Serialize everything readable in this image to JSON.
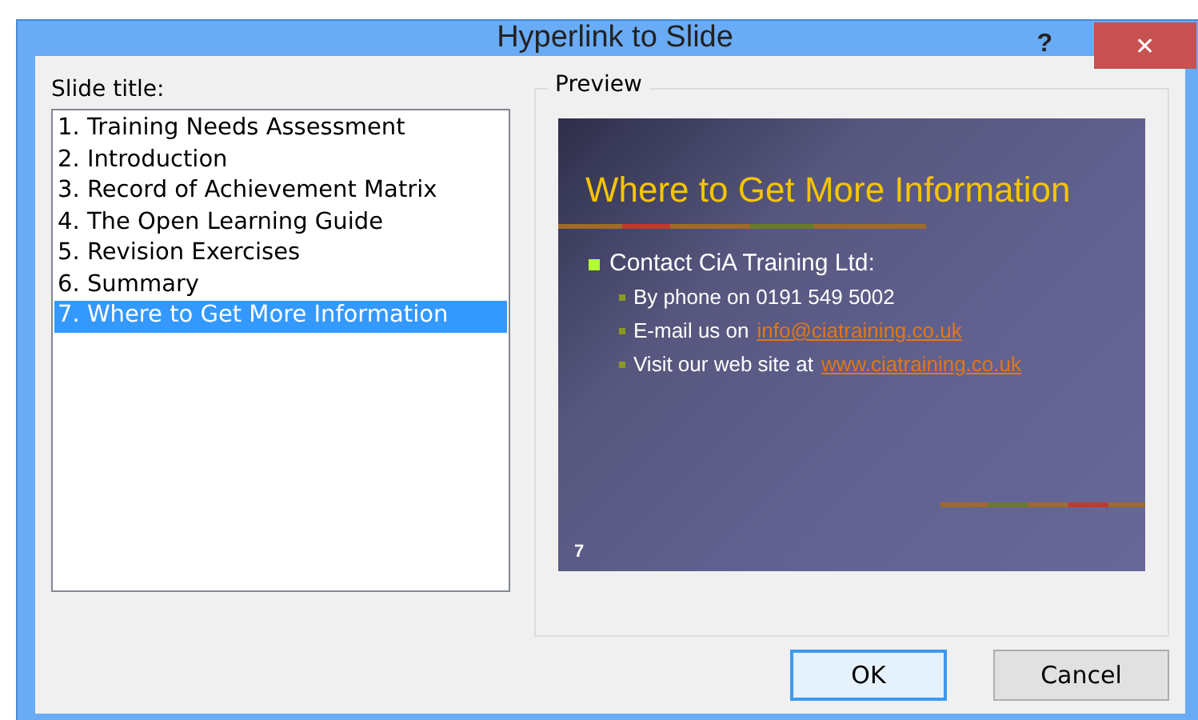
{
  "window": {
    "title": "Hyperlink to Slide",
    "help": "?",
    "close": "✕"
  },
  "slide_list": {
    "label": "Slide title:",
    "items": [
      {
        "text": "1. Training Needs Assessment",
        "selected": false
      },
      {
        "text": "2. Introduction",
        "selected": false
      },
      {
        "text": "3. Record of Achievement Matrix",
        "selected": false
      },
      {
        "text": "4. The Open Learning Guide",
        "selected": false
      },
      {
        "text": "5. Revision Exercises",
        "selected": false
      },
      {
        "text": "6. Summary",
        "selected": false
      },
      {
        "text": "7. Where to Get More Information",
        "selected": true
      }
    ]
  },
  "preview": {
    "label": "Preview",
    "slide": {
      "title": "Where to Get More Information",
      "number": "7",
      "bullets": [
        {
          "text": "Contact CiA Training Ltd:",
          "children": [
            {
              "text": "By phone on 0191 549 5002"
            },
            {
              "text": "E-mail us on",
              "link": "info@ciatraining.co.uk"
            },
            {
              "text": "Visit our web site at",
              "link": "www.ciatraining.co.uk"
            }
          ]
        }
      ]
    }
  },
  "buttons": [
    {
      "label": "OK",
      "kind": "default"
    },
    {
      "label": "Cancel",
      "kind": "normal"
    }
  ]
}
